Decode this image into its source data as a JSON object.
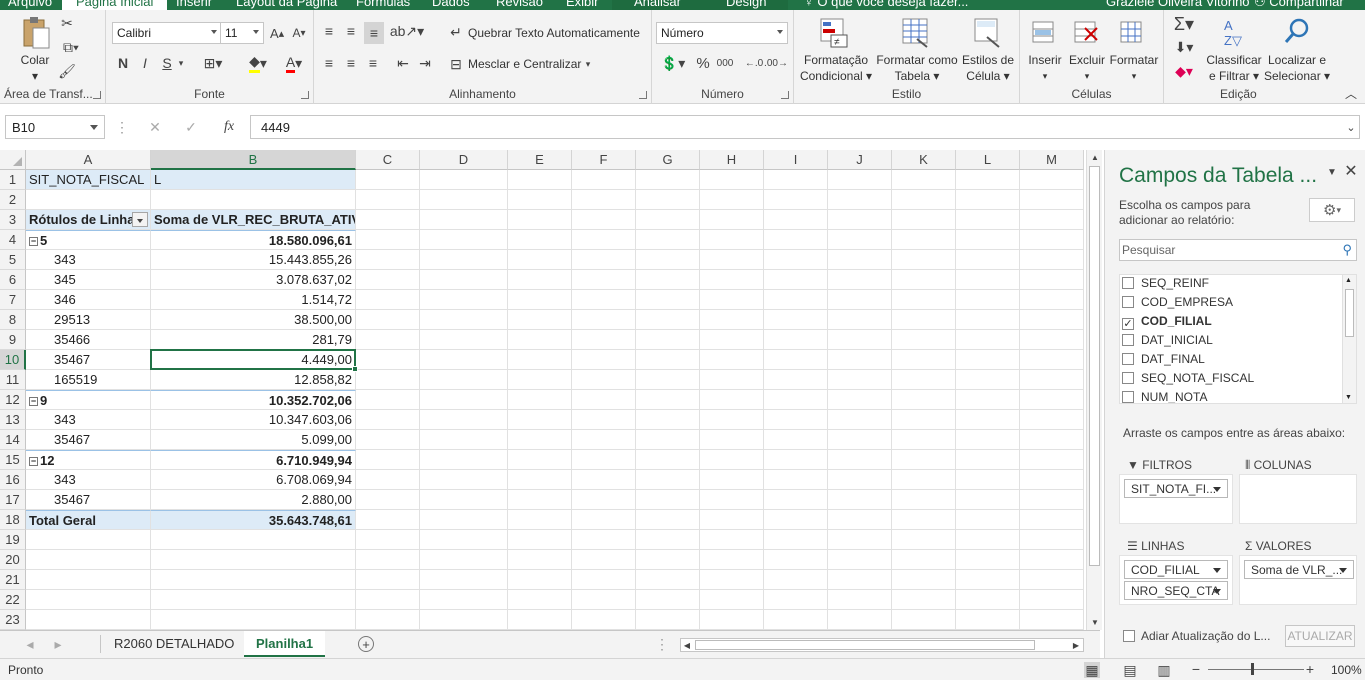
{
  "ribbon_tabs": {
    "arquivo": "Arquivo",
    "pagina_inicial": "Página Inicial",
    "inserir": "Inserir",
    "layout": "Layout da Página",
    "formulas": "Fórmulas",
    "dados": "Dados",
    "revisao": "Revisão",
    "exibir": "Exibir",
    "analisar": "Analisar",
    "design": "Design",
    "tell_me": "O que você deseja fazer...",
    "user": "Graziele Oliveira Vitorino",
    "share": "Compartilhar"
  },
  "ribbon": {
    "clipboard": {
      "paste_label": "Colar",
      "group": "Área de Transf..."
    },
    "font": {
      "name": "Calibri",
      "size": "11",
      "bold": "N",
      "italic": "I",
      "underline": "S",
      "group": "Fonte"
    },
    "alignment": {
      "wrap": "Quebrar Texto Automaticamente",
      "merge": "Mesclar e Centralizar",
      "group": "Alinhamento"
    },
    "number": {
      "format": "Número",
      "percent": "%",
      "thousands": "000",
      "group": "Número"
    },
    "styles": {
      "cond_1": "Formatação",
      "cond_2": "Condicional",
      "table_1": "Formatar como",
      "table_2": "Tabela",
      "cell_1": "Estilos de",
      "cell_2": "Célula",
      "group": "Estilo"
    },
    "cells": {
      "insert": "Inserir",
      "delete": "Excluir",
      "format": "Formatar",
      "group": "Células"
    },
    "editing": {
      "sort_1": "Classificar",
      "sort_2": "e Filtrar",
      "find_1": "Localizar e",
      "find_2": "Selecionar",
      "group": "Edição"
    }
  },
  "formula_bar": {
    "name_box": "B10",
    "fx": "fx",
    "value": "4449"
  },
  "columns": [
    "A",
    "B",
    "C",
    "D",
    "E",
    "F",
    "G",
    "H",
    "I",
    "J",
    "K",
    "L",
    "M"
  ],
  "rows": [
    "1",
    "2",
    "3",
    "4",
    "5",
    "6",
    "7",
    "8",
    "9",
    "10",
    "11",
    "12",
    "13",
    "14",
    "15",
    "16",
    "17",
    "18",
    "19",
    "20",
    "21",
    "22",
    "23"
  ],
  "pivot": {
    "filter_field": "SIT_NOTA_FISCAL",
    "filter_value": "L",
    "row_labels_header": "Rótulos de Linha",
    "values_header": "Soma de VLR_REC_BRUTA_ATIV",
    "rows": [
      {
        "label": "5",
        "value": "18.580.096,61",
        "group": true
      },
      {
        "label": "343",
        "value": "15.443.855,26"
      },
      {
        "label": "345",
        "value": "3.078.637,02"
      },
      {
        "label": "346",
        "value": "1.514,72"
      },
      {
        "label": "29513",
        "value": "38.500,00"
      },
      {
        "label": "35466",
        "value": "281,79"
      },
      {
        "label": "35467",
        "value": "4.449,00"
      },
      {
        "label": "165519",
        "value": "12.858,82"
      },
      {
        "label": "9",
        "value": "10.352.702,06",
        "group": true
      },
      {
        "label": "343",
        "value": "10.347.603,06"
      },
      {
        "label": "35467",
        "value": "5.099,00"
      },
      {
        "label": "12",
        "value": "6.710.949,94",
        "group": true
      },
      {
        "label": "343",
        "value": "6.708.069,94"
      },
      {
        "label": "35467",
        "value": "2.880,00"
      }
    ],
    "total_label": "Total Geral",
    "total_value": "35.643.748,61"
  },
  "sheets": {
    "tab1": "R2060 DETALHADO",
    "tab2": "Planilha1"
  },
  "status": {
    "ready": "Pronto",
    "zoom": "100%"
  },
  "field_pane": {
    "title": "Campos da Tabela ...",
    "instructions": "Escolha os campos para adicionar ao relatório:",
    "search_placeholder": "Pesquisar",
    "fields": [
      {
        "name": "SEQ_REINF",
        "checked": false
      },
      {
        "name": "COD_EMPRESA",
        "checked": false
      },
      {
        "name": "COD_FILIAL",
        "checked": true
      },
      {
        "name": "DAT_INICIAL",
        "checked": false
      },
      {
        "name": "DAT_FINAL",
        "checked": false
      },
      {
        "name": "SEQ_NOTA_FISCAL",
        "checked": false
      },
      {
        "name": "NUM_NOTA",
        "checked": false
      }
    ],
    "drag_hint": "Arraste os campos entre as áreas abaixo:",
    "filters_label": "FILTROS",
    "columns_label": "COLUNAS",
    "rows_label": "LINHAS",
    "values_label": "VALORES",
    "filter_pill": "SIT_NOTA_FI...",
    "row_pill_1": "COD_FILIAL",
    "row_pill_2": "NRO_SEQ_CTA",
    "value_pill": "Soma de VLR_...",
    "defer_label": "Adiar Atualização do L...",
    "update_button": "ATUALIZAR"
  },
  "colors": {
    "excel_green": "#217346",
    "pivot_header_fill": "#ddebf7"
  }
}
